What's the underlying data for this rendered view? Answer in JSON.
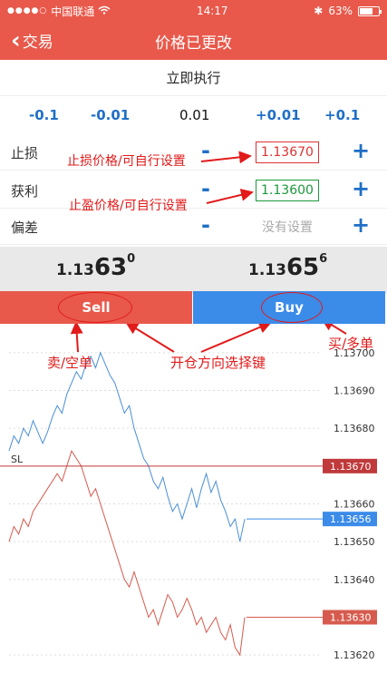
{
  "status_bar": {
    "carrier": "中国联通",
    "time": "14:17",
    "battery": "63%"
  },
  "nav": {
    "back_label": "交易",
    "title": "价格已更改"
  },
  "execution_mode": "立即执行",
  "adjust_steps": [
    "-0.1",
    "-0.01",
    "0.01",
    "+0.01",
    "+0.1"
  ],
  "orders": {
    "stop_loss": {
      "label": "止损",
      "value": "1.13670"
    },
    "take_profit": {
      "label": "获利",
      "value": "1.13600"
    },
    "deviation": {
      "label": "偏差",
      "value": "没有设置"
    }
  },
  "controls": {
    "minus": "-",
    "plus": "+"
  },
  "quotes": {
    "sell": {
      "prefix": "1.13",
      "big": "63",
      "sup": "0"
    },
    "buy": {
      "prefix": "1.13",
      "big": "65",
      "sup": "6"
    }
  },
  "buttons": {
    "sell": "Sell",
    "buy": "Buy"
  },
  "annotations": {
    "sl_note": "止损价格/可自行设置",
    "tp_note": "止盈价格/可自行设置",
    "sell_note": "卖/空单",
    "direction_note": "开仓方向选择键",
    "buy_note": "买/多单"
  },
  "chart_data": {
    "type": "line",
    "y_ticks": [
      "1.13700",
      "1.13690",
      "1.13680",
      "1.13660",
      "1.13650",
      "1.13640",
      "1.13620"
    ],
    "ylim": [
      1.13615,
      1.13705
    ],
    "sl_label": "SL",
    "levels": [
      {
        "value": 1.1367,
        "label": "1.13670",
        "color": "#c0393b"
      },
      {
        "value": 1.13656,
        "label": "1.13656",
        "color": "#3b8be8"
      },
      {
        "value": 1.1363,
        "label": "1.13630",
        "color": "#d65b4e"
      }
    ],
    "series": [
      {
        "color": "#4a8fd6",
        "values": [
          1.13674,
          1.13678,
          1.13676,
          1.1368,
          1.13678,
          1.13682,
          1.13679,
          1.13676,
          1.13679,
          1.13683,
          1.13686,
          1.13684,
          1.13689,
          1.13692,
          1.13695,
          1.13693,
          1.13697,
          1.13699,
          1.13696,
          1.137,
          1.13697,
          1.13694,
          1.13692,
          1.13688,
          1.13684,
          1.13686,
          1.1368,
          1.13676,
          1.13672,
          1.1367,
          1.13666,
          1.13664,
          1.13667,
          1.13662,
          1.13658,
          1.1366,
          1.13656,
          1.1366,
          1.13664,
          1.13659,
          1.13664,
          1.13668,
          1.13663,
          1.13666,
          1.13661,
          1.13658,
          1.13654,
          1.13656,
          1.1365,
          1.13656
        ]
      },
      {
        "color": "#d65b4e",
        "values": [
          1.1365,
          1.13654,
          1.13652,
          1.13656,
          1.13654,
          1.13658,
          1.1366,
          1.13662,
          1.13664,
          1.13666,
          1.13668,
          1.13666,
          1.1367,
          1.13674,
          1.13672,
          1.1367,
          1.13666,
          1.13662,
          1.13664,
          1.1366,
          1.13656,
          1.13652,
          1.13648,
          1.13644,
          1.1364,
          1.13638,
          1.13642,
          1.13638,
          1.13634,
          1.1363,
          1.13632,
          1.13628,
          1.13632,
          1.13636,
          1.13634,
          1.1363,
          1.13632,
          1.13635,
          1.13632,
          1.13628,
          1.1363,
          1.13626,
          1.13628,
          1.1363,
          1.13626,
          1.13624,
          1.13628,
          1.13622,
          1.1362,
          1.1363
        ]
      }
    ]
  }
}
